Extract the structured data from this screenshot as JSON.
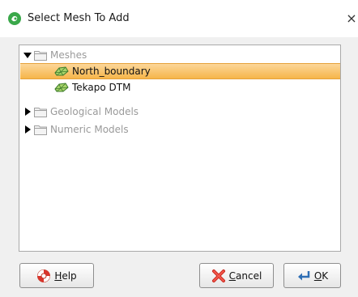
{
  "window": {
    "title": "Select Mesh To Add",
    "close_glyph": "×"
  },
  "tree": {
    "items": [
      {
        "label": "Meshes",
        "icon": "folder-icon",
        "expanded": true,
        "dimmed": true
      },
      {
        "label": "North_boundary",
        "icon": "mesh-icon",
        "selected": true
      },
      {
        "label": "Tekapo DTM",
        "icon": "mesh-icon"
      },
      {
        "label": "Geological Models",
        "icon": "folder-icon",
        "expanded": false,
        "dimmed": true
      },
      {
        "label": "Numeric Models",
        "icon": "folder-icon",
        "expanded": false,
        "dimmed": true
      }
    ]
  },
  "buttons": {
    "help": {
      "mnemonic": "H",
      "rest": "elp",
      "icon": "lifebuoy-icon"
    },
    "cancel": {
      "mnemonic": "C",
      "rest": "ancel",
      "icon": "red-x-icon"
    },
    "ok": {
      "mnemonic": "O",
      "rest": "K",
      "icon": "return-arrow-icon"
    }
  },
  "colors": {
    "selection": "#f6b54a",
    "dim_text": "#9a9a9a",
    "app_icon": "#3aa84a"
  }
}
